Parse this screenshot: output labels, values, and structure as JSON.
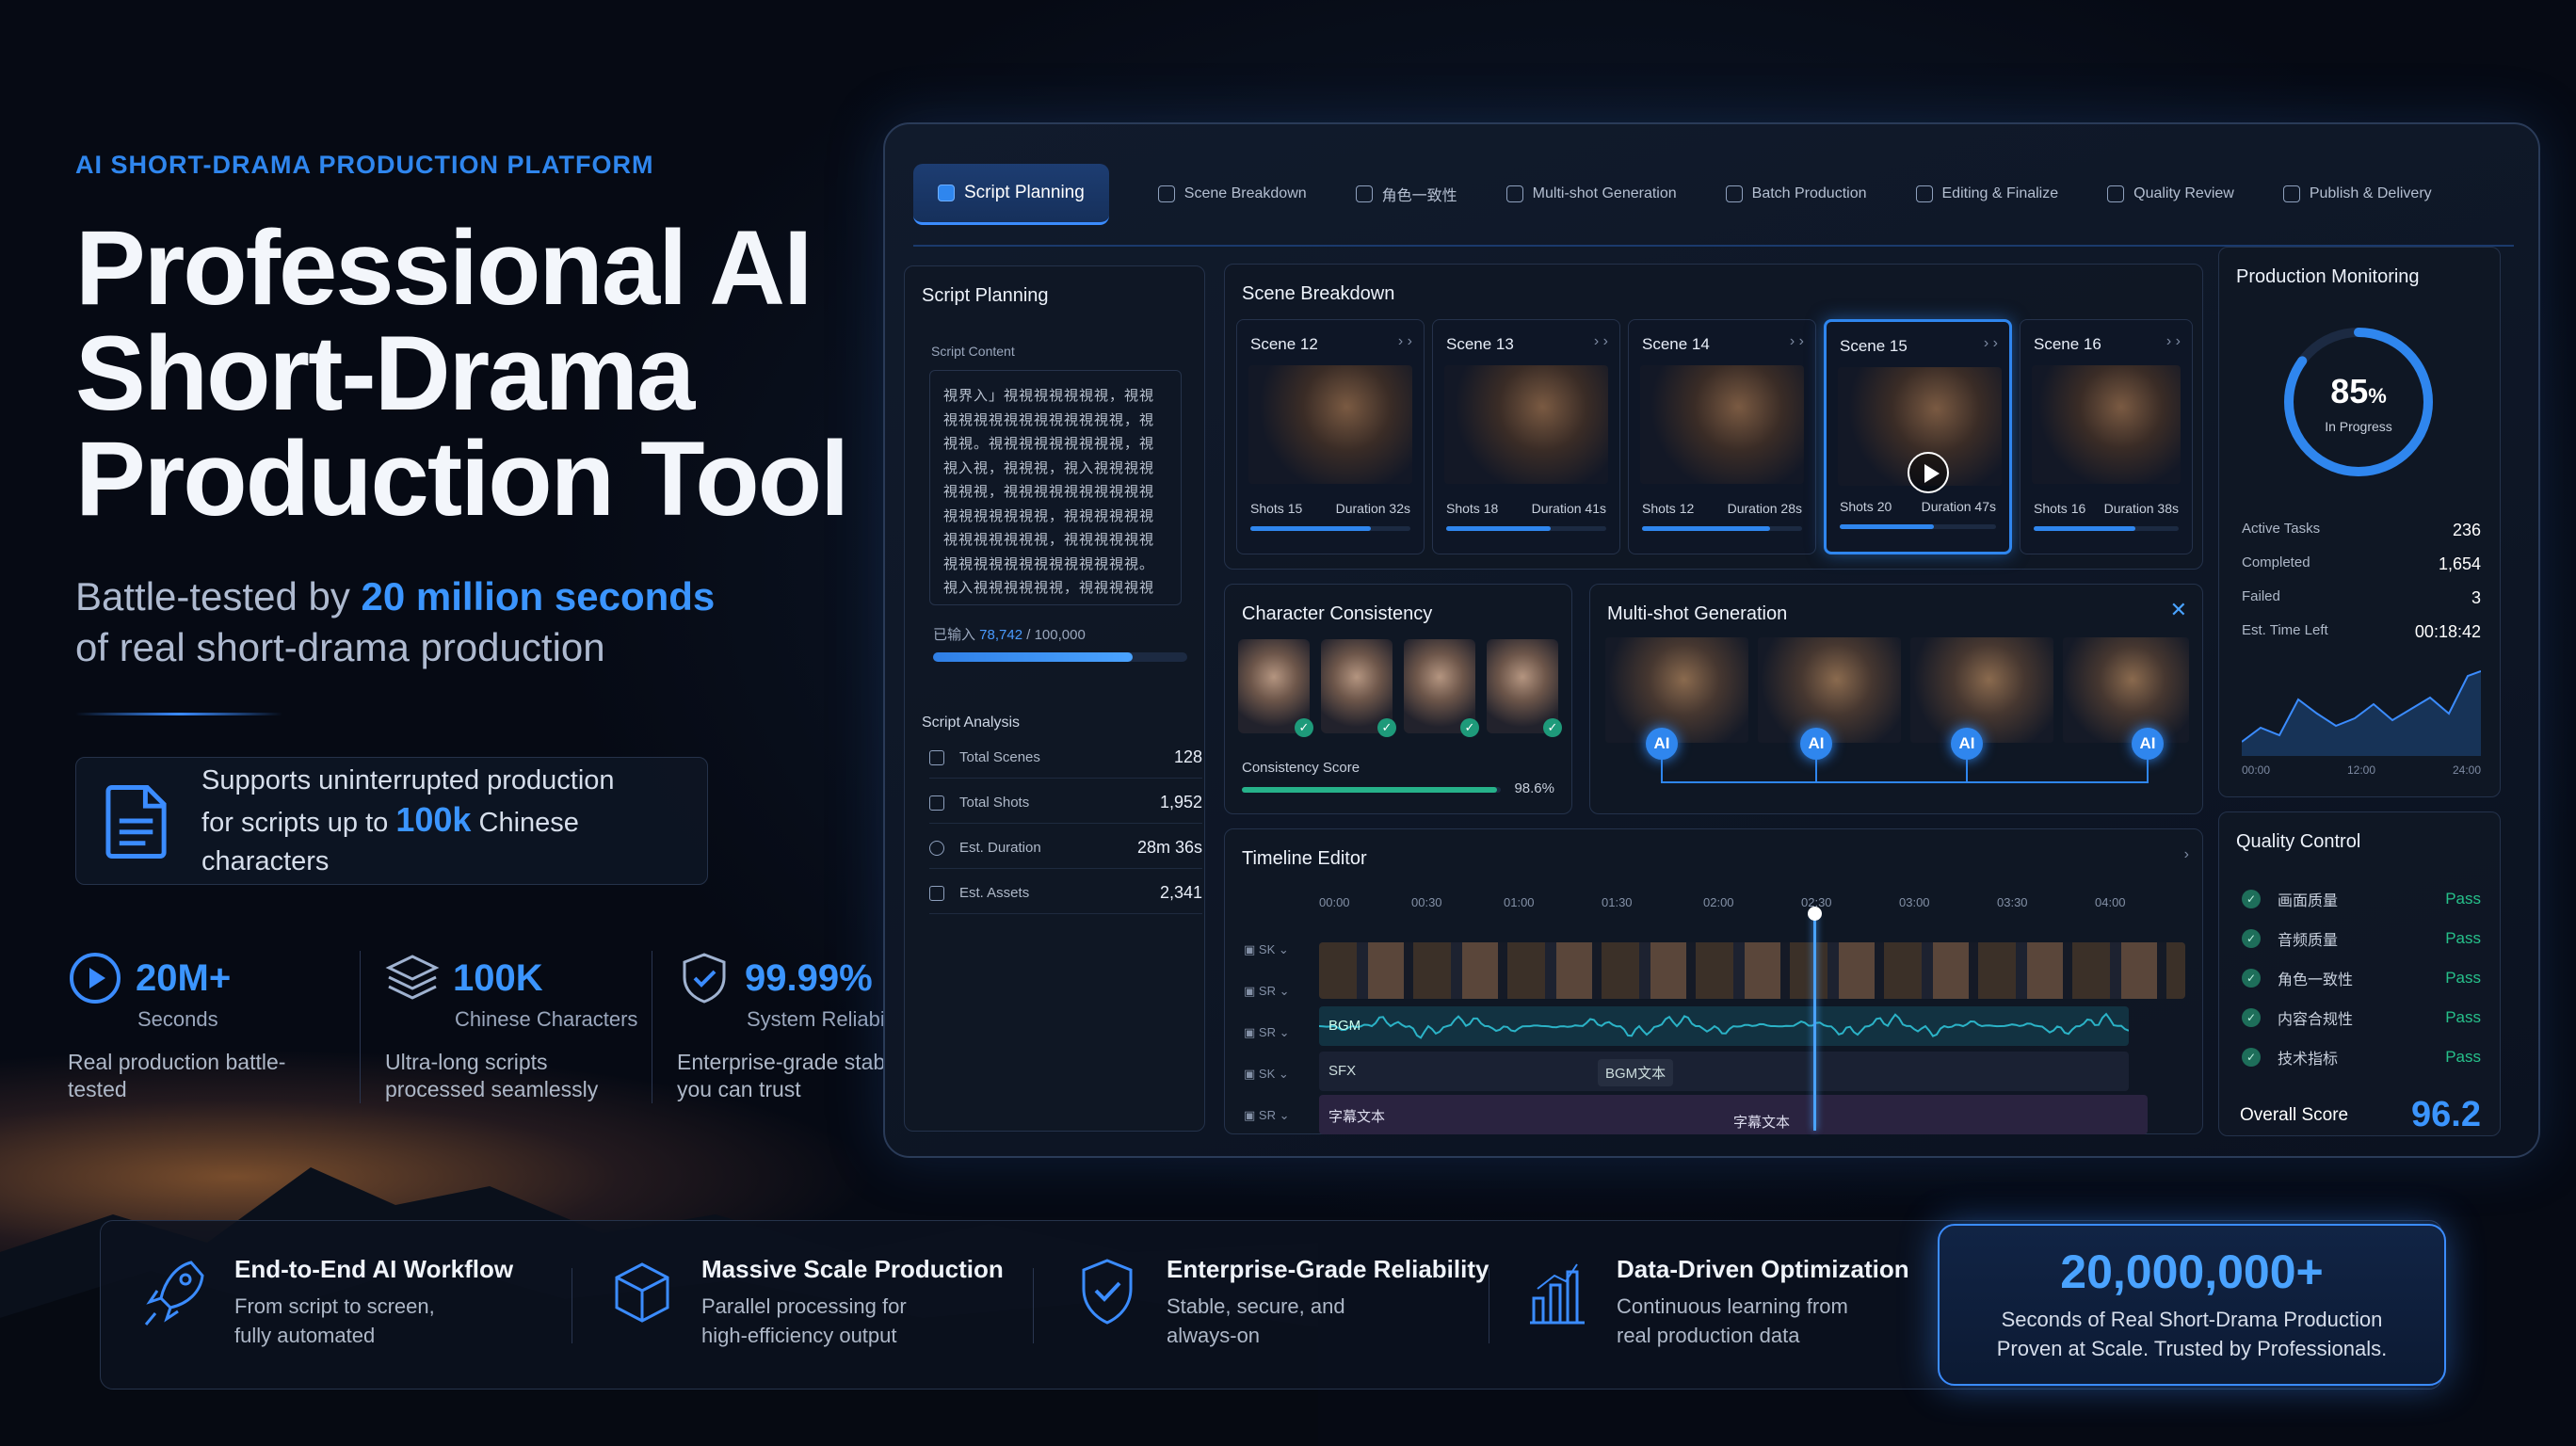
{
  "hero": {
    "kicker": "AI SHORT-DRAMA PRODUCTION PLATFORM",
    "title_l1": "Professional AI",
    "title_l2": "Short-Drama",
    "title_l3": "Production Tool",
    "sub_pre": "Battle-tested by ",
    "sub_hl": "20 million seconds",
    "sub_post": "of real short-drama production",
    "support_l1": "Supports uninterrupted production",
    "support_pre": "for scripts up to ",
    "support_hl": "100k",
    "support_post": " Chinese characters"
  },
  "stats": [
    {
      "num": "20M+",
      "unit": "Seconds",
      "desc": "Real production battle-tested"
    },
    {
      "num": "100K",
      "unit": "Chinese Characters",
      "desc": "Ultra-long scripts processed seamlessly"
    },
    {
      "num": "99.99%",
      "unit": "System Reliability",
      "desc": "Enterprise-grade stability you can trust"
    }
  ],
  "steps": [
    "Script Planning",
    "Scene Breakdown",
    "角色一致性",
    "Multi-shot Generation",
    "Batch Production",
    "Editing & Finalize",
    "Quality Review",
    "Publish & Delivery"
  ],
  "script": {
    "title": "Script Planning",
    "content_label": "Script Content",
    "content_text": "視界入」視視視視視視視，視視視視視視視視視視視視視視，視視視。視視視視視視視視視，視視入視，視視視，視入視視視視視視視，視視視視視視視視視視視視視視視視視，視視視視視視視視視視視視視，視視視視視視視視視視視視視視視視視視視。視入視視視視視視，視視視視視視視，視視視視視視視視視視視。視視視。视視視視視視視視視視視。",
    "count_pre": "已输入 ",
    "count_hl": "78,742",
    "count_post": " / 100,000",
    "progress": 0.787,
    "analysis_title": "Script Analysis",
    "analysis": [
      {
        "label": "Total Scenes",
        "value": "128"
      },
      {
        "label": "Total Shots",
        "value": "1,952"
      },
      {
        "label": "Est. Duration",
        "value": "28m 36s"
      },
      {
        "label": "Est. Assets",
        "value": "2,341"
      }
    ]
  },
  "scenes": {
    "title": "Scene Breakdown",
    "items": [
      {
        "name": "Scene 12",
        "shots": "Shots 15",
        "duration": "Duration 32s",
        "progress": 0.75
      },
      {
        "name": "Scene 13",
        "shots": "Shots 18",
        "duration": "Duration 41s",
        "progress": 0.65
      },
      {
        "name": "Scene 14",
        "shots": "Shots 12",
        "duration": "Duration 28s",
        "progress": 0.8
      },
      {
        "name": "Scene 15",
        "shots": "Shots 20",
        "duration": "Duration 47s",
        "progress": 0.6
      },
      {
        "name": "Scene 16",
        "shots": "Shots 16",
        "duration": "Duration 38s",
        "progress": 0.7
      }
    ]
  },
  "character": {
    "title": "Character Consistency",
    "score_label": "Consistency Score",
    "score": "98.6%",
    "score_fraction": 0.986
  },
  "multishot": {
    "title": "Multi-shot Generation",
    "ai_label": "AI"
  },
  "timeline": {
    "title": "Timeline Editor",
    "ticks": [
      "00:00",
      "00:30",
      "01:00",
      "01:30",
      "02:00",
      "02:30",
      "03:00",
      "03:30",
      "04:00"
    ],
    "track_labels": [
      "SK",
      "SR",
      "SR",
      "SK",
      "SR"
    ],
    "bgm": "BGM",
    "sfx": "SFX",
    "bgm_text": "BGM文本",
    "sub1": "字幕文本",
    "sub2": "字幕文本"
  },
  "monitor": {
    "title": "Production Monitoring",
    "percent": "85",
    "percent_sign": "%",
    "progress": 0.85,
    "status": "In Progress",
    "rows": [
      {
        "label": "Active Tasks",
        "value": "236"
      },
      {
        "label": "Completed",
        "value": "1,654"
      },
      {
        "label": "Failed",
        "value": "3"
      },
      {
        "label": "Est. Time Left",
        "value": "00:18:42"
      }
    ],
    "axis": [
      "00:00",
      "12:00",
      "24:00"
    ]
  },
  "quality": {
    "title": "Quality Control",
    "rows": [
      {
        "label": "画面质量",
        "status": "Pass"
      },
      {
        "label": "音频质量",
        "status": "Pass"
      },
      {
        "label": "角色一致性",
        "status": "Pass"
      },
      {
        "label": "内容合规性",
        "status": "Pass"
      },
      {
        "label": "技术指标",
        "status": "Pass"
      }
    ],
    "overall_label": "Overall Score",
    "overall": "96.2"
  },
  "features": [
    {
      "title": "End-to-End AI Workflow",
      "desc_l1": "From script to screen,",
      "desc_l2": "fully automated"
    },
    {
      "title": "Massive Scale Production",
      "desc_l1": "Parallel processing for",
      "desc_l2": "high-efficiency output"
    },
    {
      "title": "Enterprise-Grade Reliability",
      "desc_l1": "Stable, secure, and",
      "desc_l2": "always-on"
    },
    {
      "title": "Data-Driven Optimization",
      "desc_l1": "Continuous learning from",
      "desc_l2": "real production data"
    }
  ],
  "highlight": {
    "number": "20,000,000+",
    "l1": "Seconds of Real Short-Drama Production",
    "l2": "Proven at Scale. Trusted by Professionals."
  },
  "colors": {
    "accent": "#2f86ee",
    "pass": "#26c08a",
    "bg": "#070d18"
  }
}
